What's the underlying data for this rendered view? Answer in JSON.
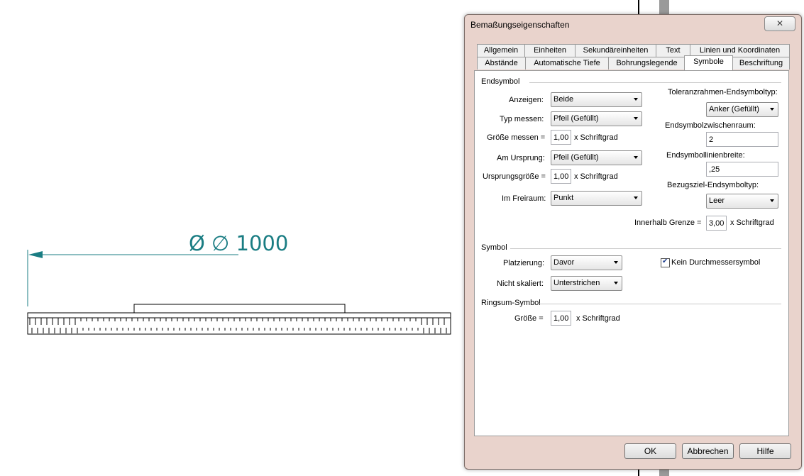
{
  "drawing": {
    "dimension_text": "Ø ∅ 1000",
    "accent_color": "#1a7d83"
  },
  "dialog": {
    "title": "Bemaßungseigenschaften",
    "close_glyph": "✕",
    "tabs_row1": [
      "Allgemein",
      "Einheiten",
      "Sekundäreinheiten",
      "Text",
      "Linien und Koordinaten"
    ],
    "tabs_row2": [
      "Abstände",
      "Automatische Tiefe",
      "Bohrungslegende",
      "Symbole",
      "Beschriftung"
    ],
    "active_tab": "Symbole",
    "endsymbol": {
      "group": "Endsymbol",
      "anzeigen_label": "Anzeigen:",
      "anzeigen_value": "Beide",
      "typ_label": "Typ messen:",
      "typ_value": "Pfeil (Gefüllt)",
      "groesse_label": "Größe messen =",
      "groesse_value": "1,00",
      "groesse_unit": "x Schriftgrad",
      "ursprung_label": "Am Ursprung:",
      "ursprung_value": "Pfeil (Gefüllt)",
      "ursprungsgroesse_label": "Ursprungsgröße =",
      "ursprungsgroesse_value": "1,00",
      "ursprungsgroesse_unit": "x Schriftgrad",
      "freiraum_label": "Im Freiraum:",
      "freiraum_value": "Punkt",
      "toleranz_label": "Toleranzrahmen-Endsymboltyp:",
      "toleranz_value": "Anker (Gefüllt)",
      "zwischenraum_label": "Endsymbolzwischenraum:",
      "zwischenraum_value": "2",
      "linienbreite_label": "Endsymbollinienbreite:",
      "linienbreite_value": ",25",
      "bezugsziel_label": "Bezugsziel-Endsymboltyp:",
      "bezugsziel_value": "Leer",
      "innerhalb_label": "Innerhalb Grenze =",
      "innerhalb_value": "3,00",
      "innerhalb_unit": "x Schriftgrad"
    },
    "symbol": {
      "group": "Symbol",
      "platzierung_label": "Platzierung:",
      "platzierung_value": "Davor",
      "skaliert_label": "Nicht skaliert:",
      "skaliert_value": "Unterstrichen",
      "kein_label": "Kein Durchmessersymbol",
      "kein_checked": "✔"
    },
    "ringsum": {
      "group": "Ringsum-Symbol",
      "groesse_label": "Größe =",
      "groesse_value": "1,00",
      "groesse_unit": "x Schriftgrad"
    },
    "buttons": {
      "ok": "OK",
      "cancel": "Abbrechen",
      "help": "Hilfe"
    }
  }
}
